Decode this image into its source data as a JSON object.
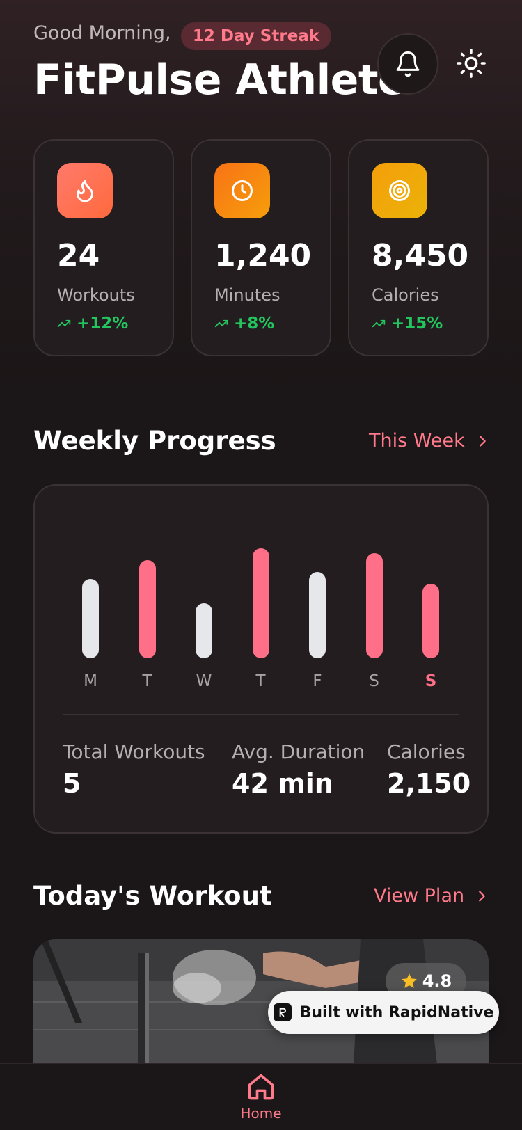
{
  "header": {
    "greeting": "Good Morning,",
    "streak": "12 Day Streak",
    "title": "FitPulse Athlete"
  },
  "stats": [
    {
      "value": "24",
      "label": "Workouts",
      "change": "+12%",
      "icon": "flame-icon",
      "color": "#ff6f5e"
    },
    {
      "value": "1,240",
      "label": "Minutes",
      "change": "+8%",
      "icon": "clock-icon",
      "color": "#f58a0b"
    },
    {
      "value": "8,450",
      "label": "Calories",
      "change": "+15%",
      "icon": "target-icon",
      "color": "#eab308"
    }
  ],
  "weekly": {
    "title": "Weekly Progress",
    "link": "This Week",
    "days": [
      "M",
      "T",
      "W",
      "T",
      "F",
      "S",
      "S"
    ],
    "levels": [
      0.66,
      0.82,
      0.46,
      0.92,
      0.72,
      0.88,
      0.62
    ],
    "highlighted": [
      false,
      true,
      false,
      true,
      false,
      true,
      true
    ],
    "today_index": 6,
    "colors": {
      "accent": "#ff7088",
      "neutral": "#e5e7eb"
    },
    "summary": [
      {
        "label": "Total Workouts",
        "value": "5"
      },
      {
        "label": "Avg. Duration",
        "value": "42 min"
      },
      {
        "label": "Calories",
        "value": "2,150"
      }
    ]
  },
  "today": {
    "title": "Today's Workout",
    "link": "View Plan",
    "rating": "4.8"
  },
  "badge": {
    "label": "Built with RapidNative"
  },
  "nav": {
    "home_label": "Home"
  }
}
